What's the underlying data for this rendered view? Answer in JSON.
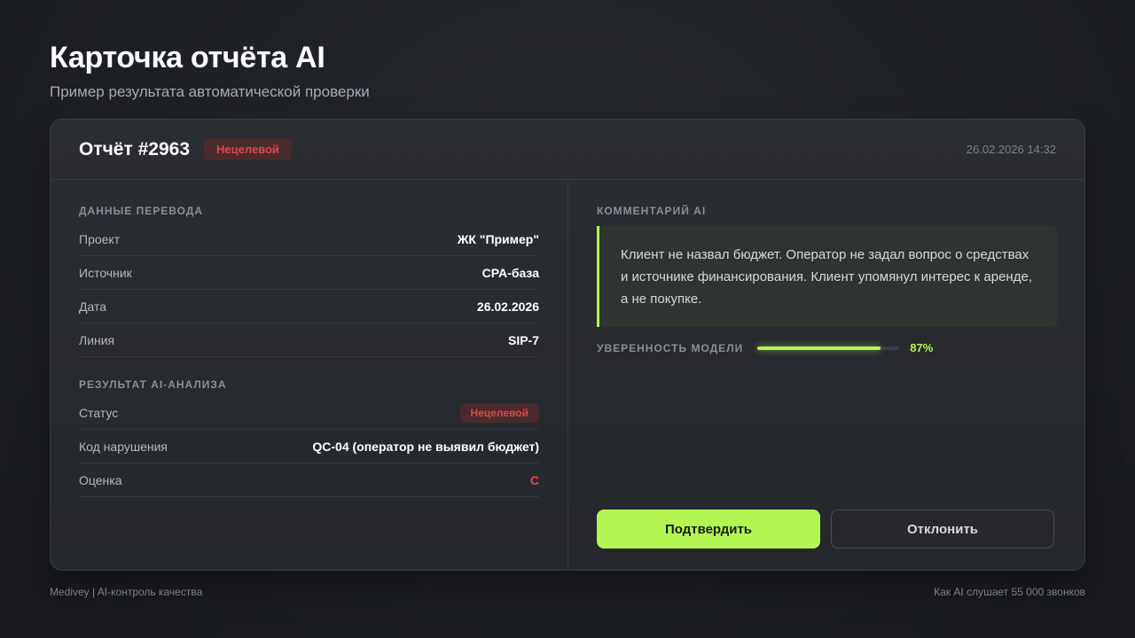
{
  "page": {
    "title": "Карточка отчёта AI",
    "subtitle": "Пример результата автоматической проверки"
  },
  "report": {
    "title": "Отчёт #2963",
    "status_badge": "Нецелевой",
    "timestamp": "26.02.2026 14:32"
  },
  "transfer": {
    "section_label": "Данные перевода",
    "rows": [
      {
        "label": "Проект",
        "value": "ЖК \"Пример\""
      },
      {
        "label": "Источник",
        "value": "CPA-база"
      },
      {
        "label": "Дата",
        "value": "26.02.2026"
      },
      {
        "label": "Линия",
        "value": "SIP-7"
      }
    ]
  },
  "analysis": {
    "section_label": "Результат AI-анализа",
    "status_label": "Статус",
    "status_value": "Нецелевой",
    "violation_label": "Код нарушения",
    "violation_value": "QC-04 (оператор не выявил бюджет)",
    "grade_label": "Оценка",
    "grade_value": "C"
  },
  "comment": {
    "section_label": "Комментарий AI",
    "text": "Клиент не назвал бюджет. Оператор не задал вопрос о средствах и источнике финансирования. Клиент упомянул интерес к аренде, а не покупке."
  },
  "confidence": {
    "label": "УВЕРЕННОСТЬ МОДЕЛИ",
    "value_text": "87%",
    "value": 0.87
  },
  "actions": {
    "confirm_label": "Подтвердить",
    "reject_label": "Отклонить"
  },
  "footer": {
    "left": "Medivey | AI-контроль качества",
    "right": "Как AI слушает 55 000 звонков"
  },
  "colors": {
    "accent": "#b3f552",
    "danger": "#e0474c",
    "background": "#1d2024"
  }
}
